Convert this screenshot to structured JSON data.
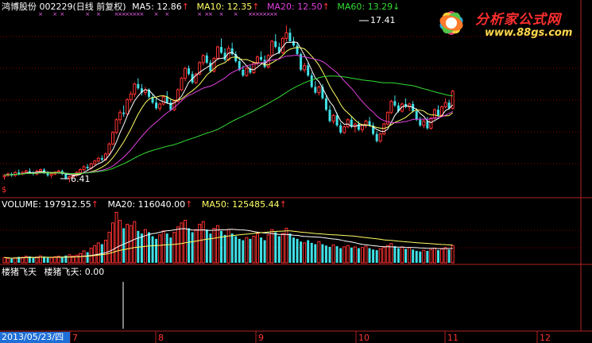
{
  "price_header": {
    "stock": "鸿博股份 002229(日线 前复权)",
    "ma5": "MA5: 12.86",
    "ma10": "MA10: 12.35",
    "ma20": "MA20: 12.50",
    "ma60": "MA60: 13.29",
    "up_arrow": "↑",
    "down_arrow": "↓"
  },
  "price_annotations": {
    "high": "17.41",
    "low": "6.41",
    "scale_mark": "$"
  },
  "volume_header": {
    "volume": "VOLUME: 197912.55",
    "ma20": "MA20: 116040.00",
    "ma50": "MA50: 125485.44",
    "up_arrow": "↑"
  },
  "indicator_header": {
    "name": "楼猪飞天",
    "value_label": "楼猪飞天: 0.00"
  },
  "logo": {
    "title": "分析家公式网",
    "url": "www.88gs.com"
  },
  "footer": {
    "date": "2013/05/23/四",
    "months": [
      "7",
      "8",
      "9",
      "10",
      "11",
      "12"
    ]
  },
  "colors": {
    "up": "#ff3232",
    "down": "#40e0e6",
    "ma5": "#ffffff",
    "ma10": "#ffff66",
    "ma20": "#e040e0",
    "ma60": "#33dd33",
    "vol_ma20": "#ffffff",
    "vol_ma50": "#ffff66",
    "grid": "#8b0000",
    "separator": "#b22222",
    "signal": "#ff66ff"
  },
  "chart_data": {
    "type": "candlestick",
    "price_range": [
      5.5,
      18.3
    ],
    "volume_max": 400000,
    "candles": [
      [
        6.8,
        7.0,
        6.6,
        6.9
      ],
      [
        6.9,
        7.1,
        6.8,
        7.0
      ],
      [
        7.0,
        7.1,
        6.8,
        6.9
      ],
      [
        6.9,
        7.2,
        6.8,
        7.1
      ],
      [
        7.1,
        7.3,
        6.9,
        7.0
      ],
      [
        7.0,
        7.2,
        6.9,
        7.1
      ],
      [
        7.1,
        7.3,
        7.0,
        7.2
      ],
      [
        7.2,
        7.4,
        7.0,
        7.1
      ],
      [
        7.1,
        7.2,
        6.9,
        7.0
      ],
      [
        7.0,
        7.3,
        6.9,
        7.2
      ],
      [
        7.2,
        7.4,
        7.1,
        7.3
      ],
      [
        7.3,
        7.4,
        7.0,
        7.1
      ],
      [
        7.1,
        7.2,
        6.8,
        6.9
      ],
      [
        6.9,
        7.1,
        6.7,
        7.0
      ],
      [
        7.0,
        7.2,
        6.9,
        7.1
      ],
      [
        7.1,
        7.3,
        7.0,
        7.2
      ],
      [
        7.2,
        7.3,
        6.9,
        7.0
      ],
      [
        7.0,
        7.1,
        6.6,
        6.7
      ],
      [
        6.7,
        6.9,
        6.4,
        6.8
      ],
      [
        6.8,
        7.0,
        6.7,
        6.9
      ],
      [
        6.9,
        7.2,
        6.8,
        7.1
      ],
      [
        7.1,
        7.4,
        7.0,
        7.3
      ],
      [
        7.3,
        7.6,
        7.2,
        7.5
      ],
      [
        7.5,
        7.7,
        7.3,
        7.4
      ],
      [
        7.4,
        7.8,
        7.3,
        7.7
      ],
      [
        7.7,
        8.0,
        7.6,
        7.9
      ],
      [
        7.9,
        8.2,
        7.8,
        8.1
      ],
      [
        8.1,
        8.3,
        7.9,
        8.0
      ],
      [
        8.0,
        8.5,
        7.9,
        8.4
      ],
      [
        8.4,
        9.2,
        8.3,
        9.1
      ],
      [
        9.1,
        10.0,
        9.0,
        9.9
      ],
      [
        9.9,
        10.9,
        9.8,
        10.8
      ],
      [
        10.8,
        11.5,
        10.5,
        11.3
      ],
      [
        11.3,
        11.8,
        11.0,
        11.2
      ],
      [
        11.2,
        12.3,
        11.1,
        12.2
      ],
      [
        12.2,
        12.8,
        12.0,
        12.6
      ],
      [
        12.6,
        13.4,
        12.4,
        13.3
      ],
      [
        13.3,
        13.7,
        12.9,
        13.0
      ],
      [
        13.0,
        13.3,
        12.5,
        12.7
      ],
      [
        12.7,
        13.1,
        12.5,
        12.9
      ],
      [
        12.9,
        13.0,
        12.3,
        12.4
      ],
      [
        12.4,
        12.6,
        11.9,
        12.0
      ],
      [
        12.0,
        12.3,
        11.5,
        11.6
      ],
      [
        11.6,
        12.0,
        11.4,
        11.9
      ],
      [
        11.9,
        12.5,
        11.8,
        12.4
      ],
      [
        12.4,
        12.8,
        11.9,
        12.0
      ],
      [
        12.0,
        12.3,
        11.4,
        11.5
      ],
      [
        11.5,
        12.2,
        11.4,
        12.1
      ],
      [
        12.1,
        13.0,
        12.0,
        12.9
      ],
      [
        12.9,
        13.8,
        12.8,
        13.7
      ],
      [
        13.7,
        14.5,
        13.5,
        14.4
      ],
      [
        14.4,
        14.6,
        13.9,
        14.0
      ],
      [
        14.0,
        14.2,
        13.3,
        13.4
      ],
      [
        13.4,
        14.1,
        13.3,
        14.0
      ],
      [
        14.0,
        14.9,
        13.9,
        14.8
      ],
      [
        14.8,
        15.4,
        14.6,
        15.3
      ],
      [
        15.3,
        15.5,
        14.7,
        14.8
      ],
      [
        14.8,
        15.0,
        14.1,
        14.2
      ],
      [
        14.2,
        15.2,
        14.1,
        15.1
      ],
      [
        15.1,
        16.0,
        15.0,
        15.9
      ],
      [
        15.9,
        16.5,
        15.4,
        15.5
      ],
      [
        15.5,
        15.8,
        14.9,
        15.0
      ],
      [
        15.0,
        16.0,
        14.9,
        15.8
      ],
      [
        15.8,
        16.2,
        15.3,
        15.4
      ],
      [
        15.4,
        15.6,
        14.8,
        14.9
      ],
      [
        14.9,
        15.2,
        14.2,
        14.3
      ],
      [
        14.3,
        14.6,
        13.8,
        13.9
      ],
      [
        13.9,
        14.5,
        13.8,
        14.4
      ],
      [
        14.4,
        14.6,
        14.0,
        14.1
      ],
      [
        14.1,
        14.9,
        14.0,
        14.8
      ],
      [
        14.8,
        15.3,
        14.6,
        15.2
      ],
      [
        15.2,
        15.6,
        14.9,
        15.0
      ],
      [
        15.0,
        15.3,
        14.4,
        14.5
      ],
      [
        14.5,
        15.4,
        14.4,
        15.3
      ],
      [
        15.3,
        16.4,
        15.2,
        16.3
      ],
      [
        16.3,
        16.8,
        15.8,
        15.9
      ],
      [
        15.9,
        16.2,
        15.4,
        15.5
      ],
      [
        15.5,
        16.6,
        15.4,
        16.5
      ],
      [
        16.5,
        17.4,
        16.3,
        16.9
      ],
      [
        16.9,
        17.2,
        16.2,
        16.3
      ],
      [
        16.3,
        16.6,
        15.9,
        16.0
      ],
      [
        16.0,
        16.2,
        15.3,
        15.4
      ],
      [
        15.4,
        15.5,
        14.2,
        14.3
      ],
      [
        14.3,
        14.8,
        14.1,
        14.6
      ],
      [
        14.6,
        14.8,
        13.8,
        13.9
      ],
      [
        13.9,
        14.1,
        13.0,
        13.1
      ],
      [
        13.1,
        13.5,
        12.6,
        12.7
      ],
      [
        12.7,
        13.2,
        12.5,
        13.1
      ],
      [
        13.1,
        13.3,
        12.2,
        12.3
      ],
      [
        12.3,
        12.5,
        11.4,
        11.5
      ],
      [
        11.5,
        11.8,
        10.6,
        10.7
      ],
      [
        10.7,
        11.2,
        10.5,
        11.1
      ],
      [
        11.1,
        11.3,
        10.3,
        10.4
      ],
      [
        10.4,
        10.6,
        9.8,
        9.9
      ],
      [
        9.9,
        10.4,
        9.8,
        10.3
      ],
      [
        10.3,
        10.9,
        10.2,
        10.8
      ],
      [
        10.8,
        11.0,
        10.2,
        10.3
      ],
      [
        10.3,
        10.6,
        9.9,
        10.5
      ],
      [
        10.5,
        10.7,
        10.0,
        10.1
      ],
      [
        10.1,
        10.5,
        9.9,
        10.4
      ],
      [
        10.4,
        10.8,
        10.2,
        10.7
      ],
      [
        10.7,
        11.0,
        10.3,
        10.4
      ],
      [
        10.4,
        10.6,
        9.7,
        9.8
      ],
      [
        9.8,
        10.0,
        9.2,
        9.3
      ],
      [
        9.3,
        9.9,
        9.2,
        9.8
      ],
      [
        9.8,
        10.6,
        9.7,
        10.5
      ],
      [
        10.5,
        11.4,
        10.4,
        11.3
      ],
      [
        11.3,
        12.2,
        11.2,
        12.1
      ],
      [
        12.1,
        12.5,
        11.7,
        11.8
      ],
      [
        11.8,
        12.0,
        11.3,
        11.4
      ],
      [
        11.4,
        12.0,
        11.3,
        11.9
      ],
      [
        11.9,
        12.3,
        11.6,
        11.7
      ],
      [
        11.7,
        12.0,
        11.4,
        11.9
      ],
      [
        11.9,
        12.1,
        11.3,
        11.4
      ],
      [
        11.4,
        11.6,
        10.7,
        10.8
      ],
      [
        10.8,
        11.0,
        10.3,
        10.4
      ],
      [
        10.4,
        10.8,
        10.2,
        10.7
      ],
      [
        10.7,
        11.0,
        10.1,
        10.2
      ],
      [
        10.2,
        11.0,
        10.1,
        10.9
      ],
      [
        10.9,
        11.6,
        10.8,
        11.5
      ],
      [
        11.5,
        11.8,
        11.0,
        11.1
      ],
      [
        11.1,
        11.8,
        11.0,
        11.7
      ],
      [
        11.7,
        12.3,
        11.6,
        12.0
      ],
      [
        12.0,
        12.2,
        11.5,
        11.6
      ],
      [
        11.6,
        12.9,
        11.5,
        12.8
      ]
    ],
    "volume": [
      40,
      35,
      30,
      38,
      45,
      42,
      50,
      48,
      36,
      44,
      52,
      46,
      40,
      38,
      46,
      50,
      42,
      55,
      60,
      52,
      58,
      70,
      90,
      80,
      110,
      130,
      150,
      140,
      170,
      230,
      300,
      380,
      320,
      260,
      290,
      280,
      310,
      240,
      220,
      250,
      230,
      200,
      180,
      210,
      240,
      220,
      190,
      230,
      270,
      300,
      320,
      260,
      230,
      250,
      290,
      310,
      250,
      220,
      260,
      280,
      240,
      210,
      250,
      220,
      200,
      180,
      170,
      190,
      180,
      200,
      220,
      190,
      170,
      210,
      250,
      230,
      200,
      220,
      260,
      220,
      190,
      180,
      160,
      150,
      170,
      150,
      140,
      160,
      140,
      130,
      120,
      135,
      125,
      110,
      120,
      130,
      115,
      120,
      110,
      115,
      125,
      110,
      100,
      95,
      105,
      115,
      130,
      145,
      125,
      110,
      120,
      105,
      115,
      100,
      90,
      85,
      95,
      90,
      100,
      110,
      95,
      105,
      115,
      100,
      130
    ],
    "volume_up": [
      1,
      1,
      0,
      1,
      0,
      1,
      1,
      0,
      0,
      1,
      1,
      0,
      0,
      1,
      1,
      1,
      0,
      0,
      1,
      1,
      1,
      1,
      1,
      0,
      1,
      1,
      1,
      0,
      1,
      1,
      1,
      1,
      1,
      0,
      1,
      1,
      1,
      0,
      0,
      1,
      0,
      0,
      0,
      1,
      1,
      0,
      0,
      1,
      1,
      1,
      1,
      0,
      0,
      1,
      1,
      1,
      0,
      0,
      1,
      1,
      0,
      0,
      1,
      0,
      0,
      0,
      0,
      1,
      0,
      1,
      1,
      0,
      0,
      1,
      1,
      0,
      0,
      1,
      1,
      0,
      0,
      0,
      0,
      1,
      0,
      0,
      0,
      1,
      0,
      0,
      0,
      1,
      0,
      0,
      1,
      1,
      0,
      1,
      0,
      1,
      1,
      0,
      0,
      0,
      1,
      1,
      1,
      1,
      0,
      0,
      1,
      0,
      1,
      0,
      0,
      0,
      1,
      0,
      1,
      1,
      0,
      1,
      1,
      0,
      1
    ],
    "ma5": [],
    "ma10": [],
    "ma20": [],
    "ma60": [],
    "signal_bar_index": 38,
    "month_ticks": [
      {
        "label": "7",
        "index": 22
      },
      {
        "label": "8",
        "index": 47
      },
      {
        "label": "9",
        "index": 72
      },
      {
        "label": "10",
        "index": 97
      },
      {
        "label": "11",
        "index": 122
      },
      {
        "label": "12",
        "index": 147
      }
    ]
  }
}
